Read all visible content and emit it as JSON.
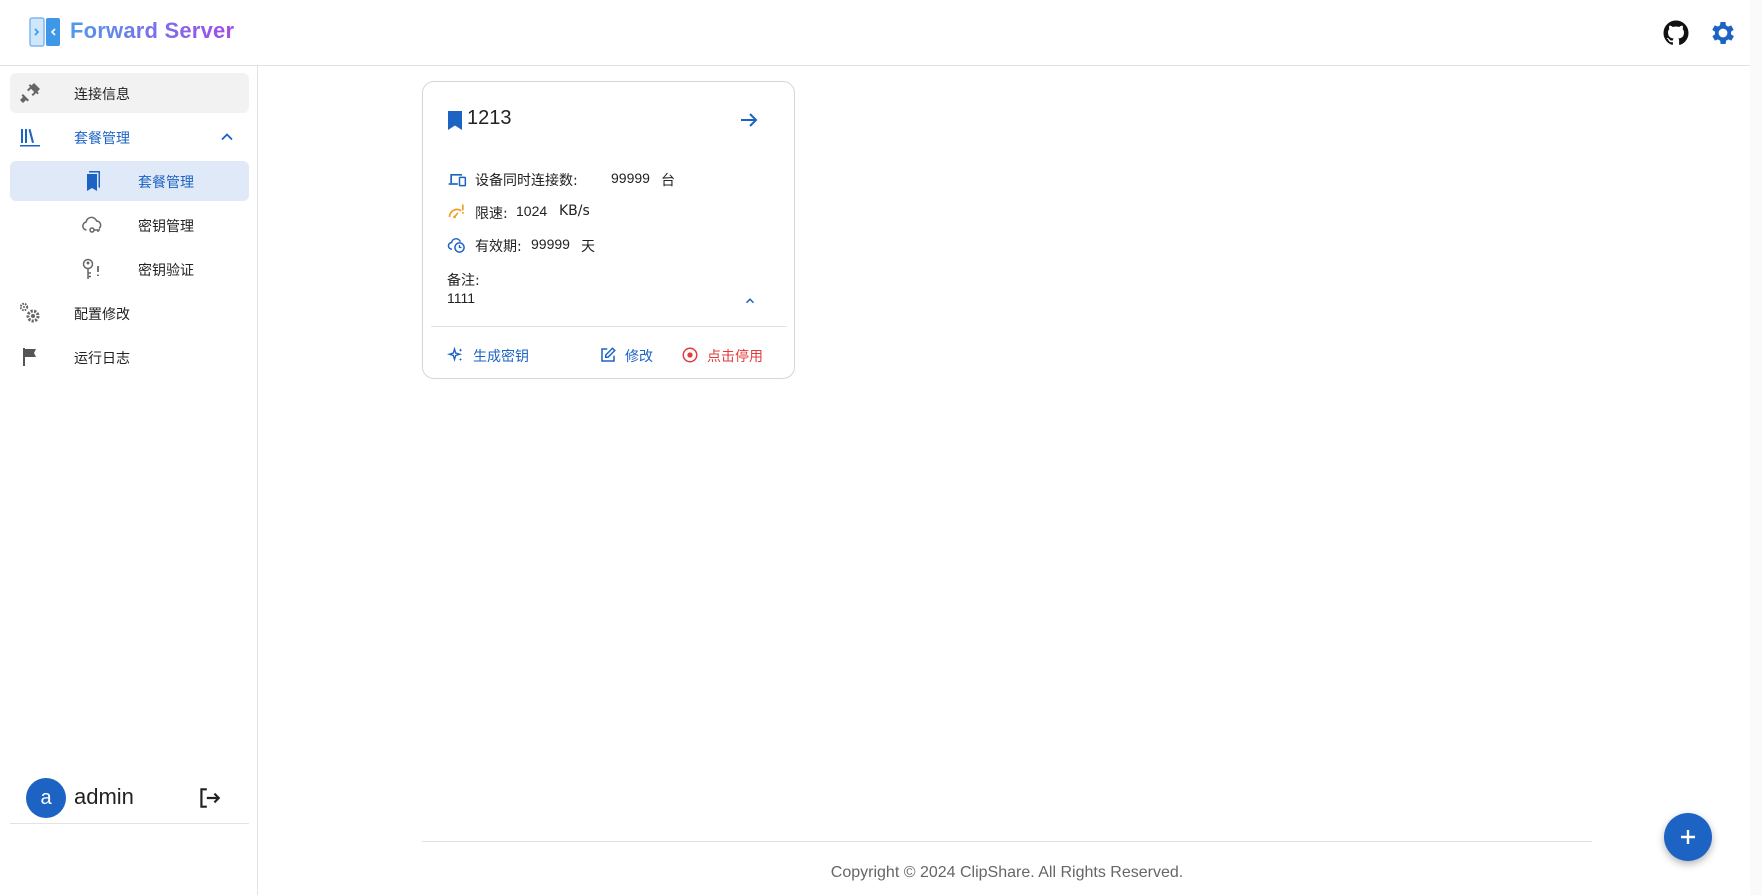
{
  "header": {
    "app_title": "Forward Server",
    "logo_icon": "door-forward-logo",
    "github_icon": "github-icon",
    "settings_icon": "gear-icon"
  },
  "sidebar": {
    "items": [
      {
        "label": "连接信息",
        "icon": "plug-icon"
      },
      {
        "label": "套餐管理",
        "icon": "books-icon",
        "expanded": true,
        "children": [
          {
            "label": "套餐管理",
            "icon": "bookmarks-icon",
            "active": true
          },
          {
            "label": "密钥管理",
            "icon": "cloud-key-icon"
          },
          {
            "label": "密钥验证",
            "icon": "key-alert-icon"
          }
        ]
      },
      {
        "label": "配置修改",
        "icon": "cogs-icon"
      },
      {
        "label": "运行日志",
        "icon": "flag-icon"
      }
    ],
    "user": {
      "avatar_letter": "a",
      "name": "admin",
      "logout_icon": "logout-icon"
    }
  },
  "plan_card": {
    "title": "1213",
    "connections": {
      "label": "设备同时连接数:",
      "value": "99999",
      "unit": "台"
    },
    "speed": {
      "label": "限速:",
      "value": "1024",
      "unit": "KB/s"
    },
    "validity": {
      "label": "有效期:",
      "value": "99999",
      "unit": "天"
    },
    "note_label": "备注:",
    "note_value": "1111",
    "actions": {
      "generate": "生成密钥",
      "edit": "修改",
      "disable": "点击停用"
    }
  },
  "footer": {
    "copyright": "Copyright © 2024 ClipShare. All Rights Reserved."
  },
  "colors": {
    "primary": "#1d63c4",
    "danger": "#e23b3b",
    "warning": "#f0a020",
    "active_bg": "#dfe9f7"
  }
}
